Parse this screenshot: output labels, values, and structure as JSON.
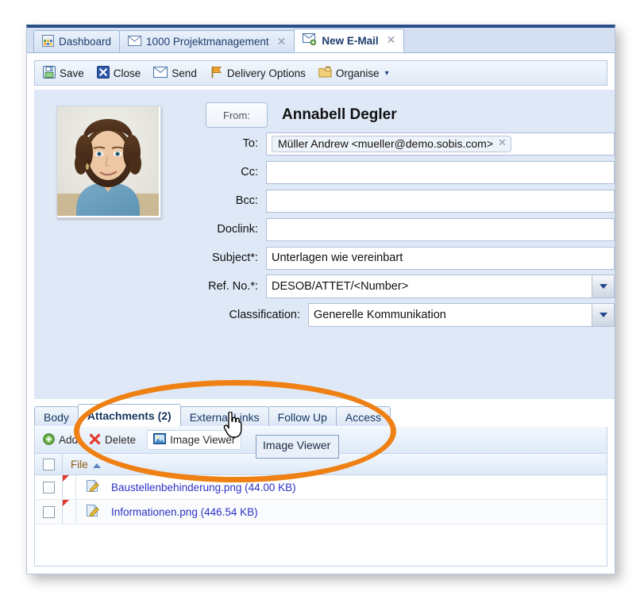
{
  "window": {
    "tabs": [
      {
        "label": "Dashboard",
        "icon": "dashboard-grid-icon",
        "closable": false,
        "active": false
      },
      {
        "label": "1000 Projektmanagement",
        "icon": "envelope-icon",
        "closable": true,
        "active": false
      },
      {
        "label": "New E-Mail",
        "icon": "new-envelope-icon",
        "closable": true,
        "active": true
      }
    ]
  },
  "toolbar": {
    "items": [
      {
        "label": "Save",
        "icon": "floppy-disk-icon",
        "caret": false
      },
      {
        "label": "Close",
        "icon": "close-x-icon",
        "caret": false
      },
      {
        "label": "Send",
        "icon": "envelope-icon",
        "caret": false
      },
      {
        "label": "Delivery Options",
        "icon": "flag-icon",
        "caret": false
      },
      {
        "label": "Organise",
        "icon": "folder-lock-icon",
        "caret": true
      }
    ],
    "caret_glyph": "▾"
  },
  "form": {
    "from_button_label": "From:",
    "from_name": "Annabell Degler",
    "fields": [
      {
        "label": "To:",
        "value": "Müller Andrew <mueller@demo.sobis.com>",
        "type": "chip",
        "placeholder": ""
      },
      {
        "label": "Cc:",
        "value": "",
        "type": "text",
        "placeholder": ""
      },
      {
        "label": "Bcc:",
        "value": "",
        "type": "text",
        "placeholder": ""
      },
      {
        "label": "Doclink:",
        "value": "",
        "type": "text",
        "placeholder": ""
      },
      {
        "label": "Subject*:",
        "value": "Unterlagen wie vereinbart",
        "type": "text",
        "placeholder": ""
      },
      {
        "label": "Ref. No.*:",
        "value": "DESOB/ATTET/<Number>",
        "type": "combo",
        "placeholder": ""
      },
      {
        "label": "Classification:",
        "value": "Generelle Kommunikation",
        "type": "combo",
        "placeholder": ""
      }
    ],
    "chip_remove_glyph": "✕"
  },
  "subtabs": [
    {
      "label": "Body",
      "active": false
    },
    {
      "label": "Attachments (2)",
      "active": true
    },
    {
      "label": "External Links",
      "active": false
    },
    {
      "label": "Follow Up",
      "active": false
    },
    {
      "label": "Access",
      "active": false
    }
  ],
  "attachments": {
    "toolbar": [
      {
        "label": "Add",
        "icon": "plus-circle-icon",
        "boxed": false
      },
      {
        "label": "Delete",
        "icon": "red-x-icon",
        "boxed": false
      },
      {
        "label": "Image Viewer",
        "icon": "picture-icon",
        "boxed": true
      }
    ],
    "column_header": "File",
    "sort_direction": "asc",
    "rows": [
      {
        "name": "Baustellenbehinderung.png (44.00 KB)",
        "icon": "edit-document-icon",
        "flagged": true,
        "checked": false
      },
      {
        "name": "Informationen.png (446.54 KB)",
        "icon": "edit-document-icon",
        "flagged": true,
        "checked": false
      }
    ]
  },
  "tooltip": {
    "text": "Image Viewer"
  },
  "annotation": {
    "highlight_color": "#ef8013",
    "shape": "ellipse"
  }
}
